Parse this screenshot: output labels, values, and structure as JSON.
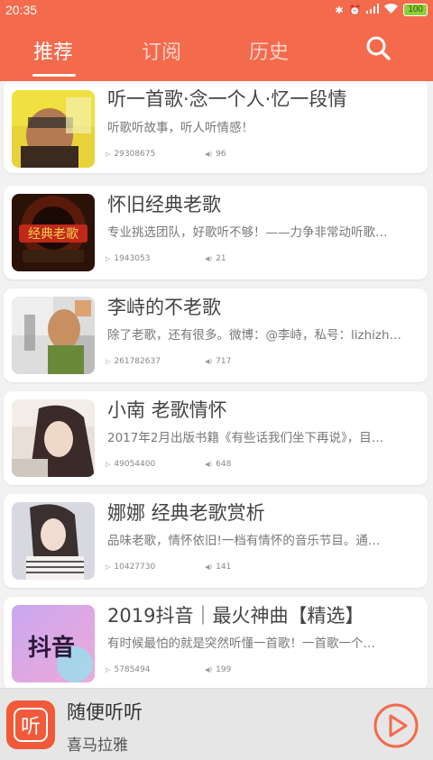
{
  "status": {
    "time": "20:35",
    "battery": "100"
  },
  "nav": {
    "tabs": [
      "推荐",
      "订阅",
      "历史"
    ],
    "active_index": 0,
    "search_icon": "search-icon"
  },
  "items": [
    {
      "title": "听一首歌·念一个人·忆一段情",
      "desc": "听歌听故事，听人听情感！",
      "plays": "29308675",
      "count": "96"
    },
    {
      "title": "怀旧经典老歌",
      "desc": "专业挑选团队，好歌听不够！——力争非常动听歌…",
      "plays": "1943053",
      "count": "21"
    },
    {
      "title": "李峙的不老歌",
      "desc": "除了老歌，还有很多。微博：@李峙，私号：lizhizh…",
      "plays": "261782637",
      "count": "717"
    },
    {
      "title": "小南 老歌情怀",
      "desc": "2017年2月出版书籍《有些话我们坐下再说》，目…",
      "plays": "49054400",
      "count": "648"
    },
    {
      "title": "娜娜 经典老歌赏析",
      "desc": "品味老歌，情怀依旧!一档有情怀的音乐节目。通…",
      "plays": "10427730",
      "count": "141"
    },
    {
      "title": "2019抖音｜最火神曲【精选】",
      "desc": "有时候最怕的就是突然听懂一首歌！一首歌一个…",
      "plays": "5785494",
      "count": "199"
    }
  ],
  "thumb_text": {
    "item2": "经典老歌",
    "item6": "抖音"
  },
  "player": {
    "logo_char": "听",
    "title": "随便听听",
    "subtitle": "喜马拉雅"
  },
  "colors": {
    "accent": "#f46a4c",
    "play_button": "#f46a4c"
  }
}
